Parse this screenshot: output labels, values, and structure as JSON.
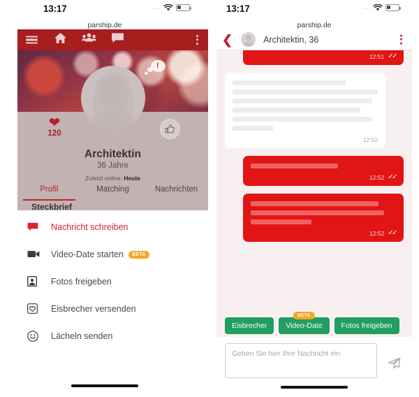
{
  "status_bar": {
    "time": "13:17",
    "signal_dots": "....",
    "wifi_icon": "wifi-icon",
    "battery_icon": "battery-icon"
  },
  "browser": {
    "url": "parship.de"
  },
  "left_phone": {
    "app_header": {
      "menu_icon": "hamburger-menu-icon",
      "home_icon": "home-icon",
      "matches_icon": "people-group-icon",
      "messages_icon": "chat-bubble-icon",
      "overflow_icon": "kebab-menu-icon"
    },
    "hero": {
      "notification_icon": "thought-bubble-exclamation-icon",
      "avatar_icon": "default-female-avatar-icon"
    },
    "profile": {
      "heart_icon": "heart-icon",
      "heart_count": "120",
      "thumbs_up_icon": "thumbs-up-icon",
      "name": "Architektin",
      "age": "36 Jahre",
      "last_online_label": "Zuletzt online:",
      "last_online_value": "Heute",
      "section_title": "Steckbrief",
      "tabs": [
        {
          "label": "Profil",
          "active": true
        },
        {
          "label": "Matching",
          "active": false
        },
        {
          "label": "Nachrichten",
          "active": false
        }
      ]
    },
    "action_sheet": [
      {
        "label": "Nachricht schreiben",
        "icon": "speech-bubble-icon",
        "badge": "",
        "highlight": true
      },
      {
        "label": "Video-Date starten",
        "icon": "video-camera-icon",
        "badge": "BETA",
        "highlight": false
      },
      {
        "label": "Fotos freigeben",
        "icon": "photo-portrait-icon",
        "badge": "",
        "highlight": false
      },
      {
        "label": "Eisbrecher versenden",
        "icon": "heart-in-square-icon",
        "badge": "",
        "highlight": false
      },
      {
        "label": "Lächeln senden",
        "icon": "smiley-face-icon",
        "badge": "",
        "highlight": false
      }
    ]
  },
  "right_phone": {
    "chat_header": {
      "back_icon": "chevron-left-icon",
      "avatar_icon": "contact-avatar-icon",
      "title": "Architektin, 36",
      "overflow_icon": "kebab-menu-icon"
    },
    "messages": [
      {
        "side": "out",
        "lines": [],
        "time": "12:51",
        "read_icon": "double-check-icon",
        "clipped": true
      },
      {
        "side": "in",
        "lines": [
          78,
          100,
          96,
          88,
          96,
          28
        ],
        "time": "12:52",
        "read_icon": ""
      },
      {
        "side": "out",
        "lines": [
          60
        ],
        "time": "12:52",
        "read_icon": "double-check-icon"
      },
      {
        "side": "out",
        "lines": [
          88,
          92,
          42
        ],
        "time": "12:52",
        "read_icon": "double-check-icon"
      }
    ],
    "quick_actions": [
      {
        "label": "Eisbrecher",
        "badge": ""
      },
      {
        "label": "Video-Date",
        "badge": "BETA"
      },
      {
        "label": "Fotos freigeben",
        "badge": ""
      }
    ],
    "composer": {
      "placeholder": "Geben Sie hier Ihre Nachricht ein",
      "value": "",
      "send_icon": "send-paper-plane-icon"
    }
  },
  "colors": {
    "brand_red": "#a81d1d",
    "accent_red": "#c8202c",
    "bubble_red": "#e21515",
    "green": "#1f9e5f",
    "beta_orange": "#f5a623",
    "chat_bg": "#f8f0f0"
  }
}
